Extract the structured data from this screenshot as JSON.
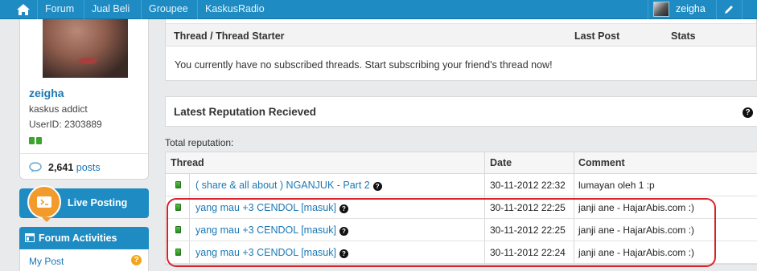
{
  "nav": {
    "items": [
      "Forum",
      "Jual Beli",
      "Groupee",
      "KaskusRadio"
    ],
    "username": "zeigha"
  },
  "profile": {
    "name": "zeigha",
    "rank": "kaskus addict",
    "user_id": "UserID: 2303889",
    "post_count": "2,641",
    "posts_label": "posts"
  },
  "sidebar": {
    "live_posting": "Live Posting",
    "activities_title": "Forum Activities",
    "my_post": "My Post"
  },
  "subscribed": {
    "col_thread": "Thread / Thread Starter",
    "col_last_post": "Last Post",
    "col_stats": "Stats",
    "empty_message": "You currently have no subscribed threads. Start subscribing your friend's thread now!"
  },
  "reputation": {
    "title": "Latest Reputation Recieved",
    "total_label": "Total reputation:",
    "columns": {
      "thread": "Thread",
      "date": "Date",
      "comment": "Comment"
    },
    "rows": [
      {
        "thread": "( share & all about ) NGANJUK - Part 2",
        "date": "30-11-2012 22:32",
        "comment": "lumayan oleh 1 :p"
      },
      {
        "thread": "yang mau +3 CENDOL [masuk]",
        "date": "30-11-2012 22:25",
        "comment": "janji ane - HajarAbis.com :)"
      },
      {
        "thread": "yang mau +3 CENDOL [masuk]",
        "date": "30-11-2012 22:25",
        "comment": "janji ane - HajarAbis.com :)"
      },
      {
        "thread": "yang mau +3 CENDOL [masuk]",
        "date": "30-11-2012 22:24",
        "comment": "janji ane - HajarAbis.com :)"
      }
    ]
  },
  "colors": {
    "brand_blue": "#1e8bc3",
    "link_blue": "#1a78b5",
    "badge_orange": "#f39a2c",
    "rep_green": "#3aa62b",
    "highlight_red": "#d8222a"
  },
  "icons": [
    "home-icon",
    "edit-pencil-icon",
    "posts-chat-icon",
    "reputation-gem-icon",
    "help-icon",
    "live-posting-icon",
    "forum-activities-icon"
  ]
}
